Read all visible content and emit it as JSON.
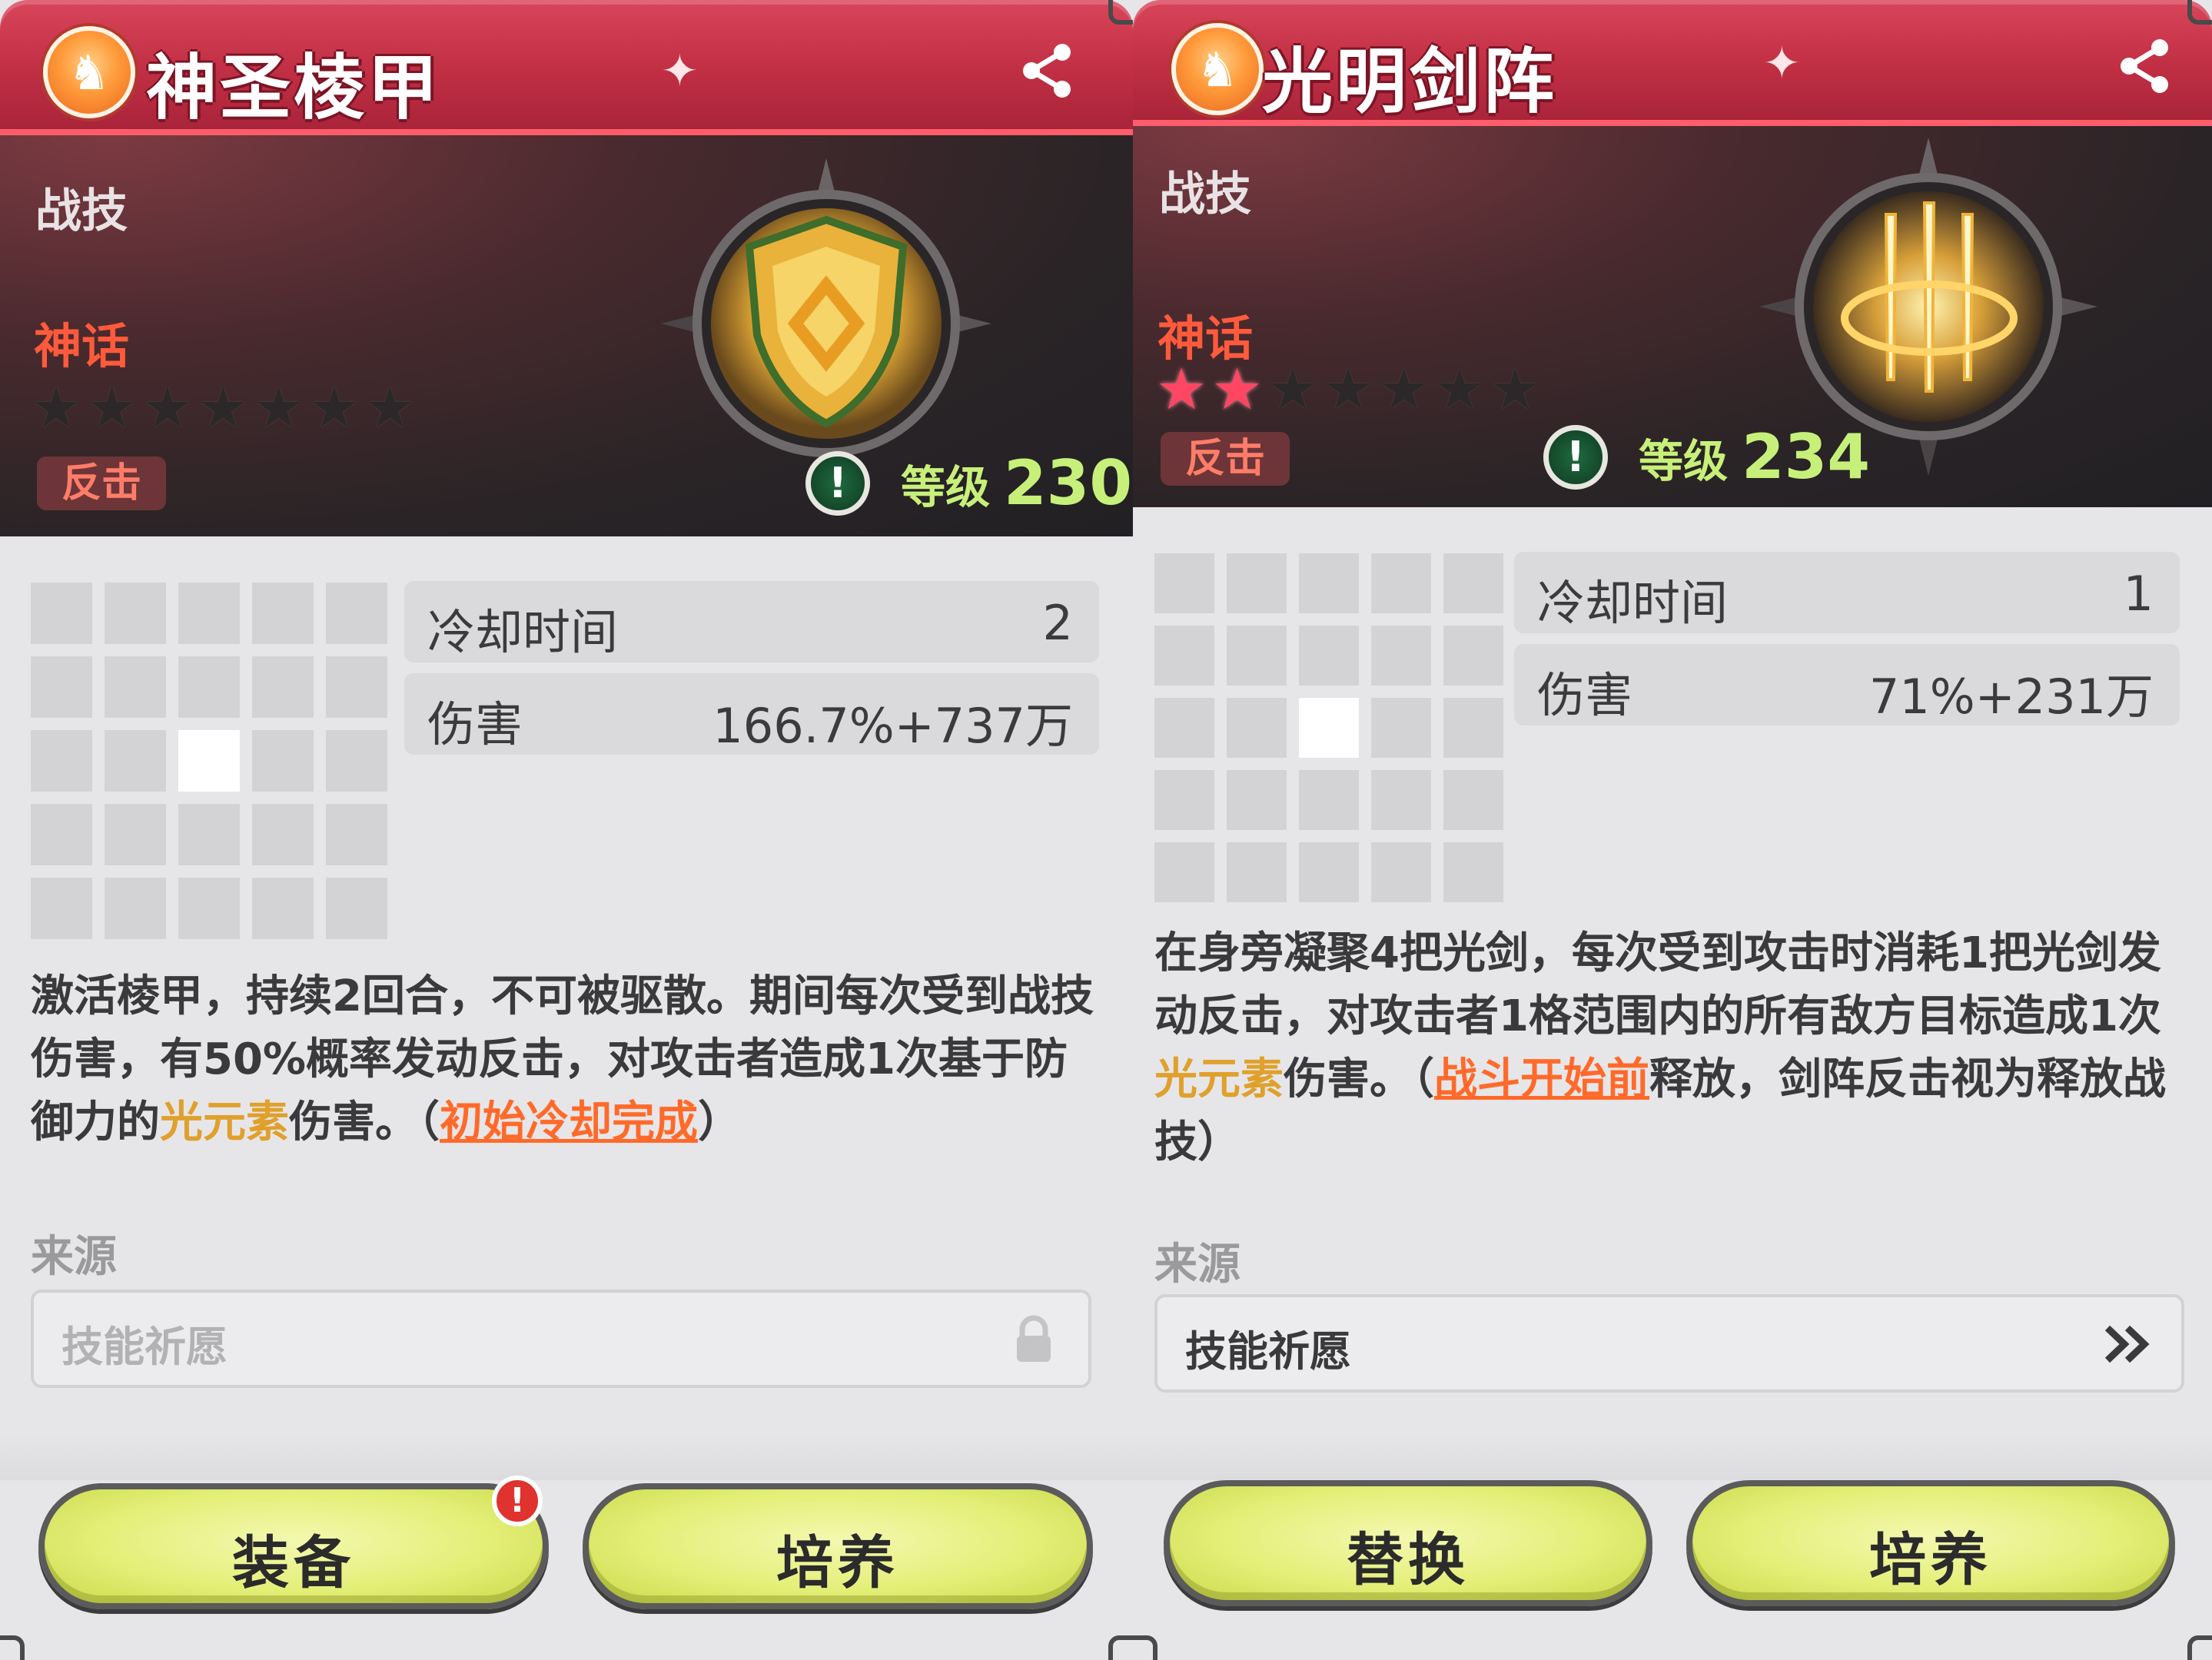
{
  "panels": [
    {
      "title": "神圣棱甲",
      "category": "战技",
      "rarity": "神话",
      "stars_lit": 0,
      "stars_total": 7,
      "tag": "反击",
      "level_label": "等级",
      "level_value": "230",
      "stats": [
        {
          "label": "冷却时间",
          "value": "2"
        },
        {
          "label": "伤害",
          "value": "166.7%+737万"
        }
      ],
      "grid_highlight": [
        2,
        2
      ],
      "description": {
        "part1": "激活棱甲，持续2回合，不可被驱散。期间每次受到战技伤害，有50%概率发动反击，对攻击者造成1次基于防御力的",
        "element": "光元素",
        "part2": "伤害。（",
        "link": "初始冷却完成",
        "part3": "）"
      },
      "source_label": "来源",
      "source_value": "技能祈愿",
      "source_icon": "lock-icon",
      "buttons": [
        {
          "label": "装备",
          "badge": "!"
        },
        {
          "label": "培养"
        }
      ]
    },
    {
      "title": "光明剑阵",
      "category": "战技",
      "rarity": "神话",
      "stars_lit": 2,
      "stars_total": 7,
      "tag": "反击",
      "level_label": "等级",
      "level_value": "234",
      "stats": [
        {
          "label": "冷却时间",
          "value": "1"
        },
        {
          "label": "伤害",
          "value": "71%+231万"
        }
      ],
      "grid_highlight": [
        2,
        2
      ],
      "description": {
        "part1": "在身旁凝聚4把光剑，每次受到攻击时消耗1把光剑发动反击，对攻击者1格范围内的所有敌方目标造成1次",
        "element": "光元素",
        "part2": "伤害。（",
        "link": "战斗开始前",
        "part3": "释放，剑阵反击视为释放战技）"
      },
      "source_label": "来源",
      "source_value": "技能祈愿",
      "source_icon": "double-chevron-right-icon",
      "buttons": [
        {
          "label": "替换"
        },
        {
          "label": "培养"
        }
      ]
    }
  ],
  "colors": {
    "title_bar": "#c12f44",
    "rarity": "#ff5a3c",
    "level": "#c7f07a",
    "element_text": "#e0a02c",
    "link_text": "#ff6a2b",
    "star_on": "#ff4662",
    "button": "#e4ef78"
  }
}
